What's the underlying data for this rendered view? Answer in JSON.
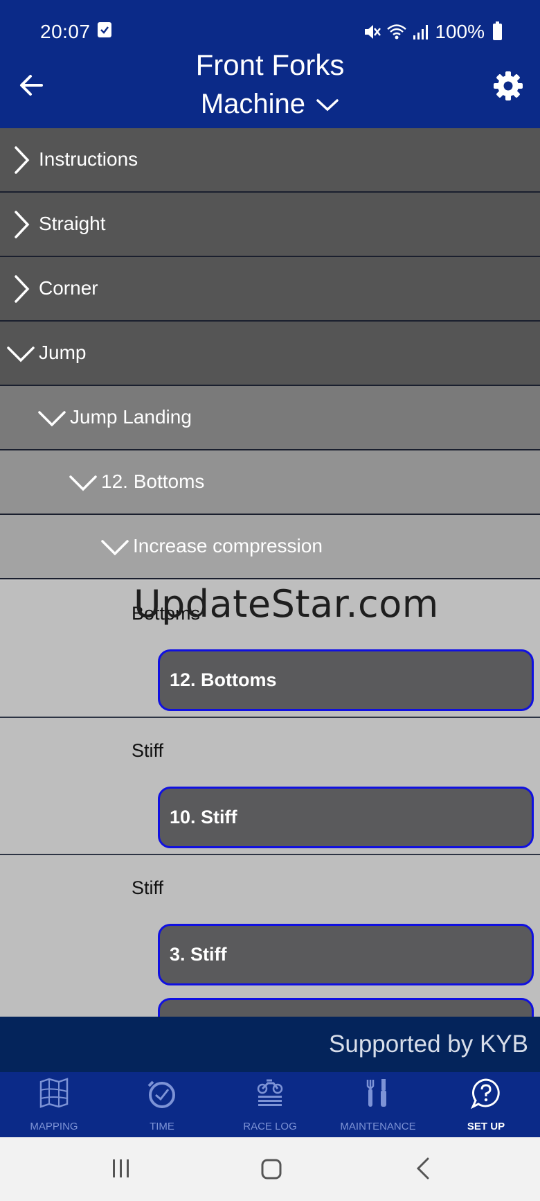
{
  "status": {
    "time": "20:07",
    "battery": "100%"
  },
  "header": {
    "title": "Front Forks",
    "subtitle": "Machine"
  },
  "accordion": [
    {
      "label": "Instructions",
      "expanded": false
    },
    {
      "label": "Straight",
      "expanded": false
    },
    {
      "label": "Corner",
      "expanded": false
    },
    {
      "label": "Jump",
      "expanded": true
    },
    {
      "label": "Jump Landing",
      "expanded": true
    },
    {
      "label": "12. Bottoms",
      "expanded": true
    },
    {
      "label": "Increase compression",
      "expanded": true
    }
  ],
  "groups": [
    {
      "title": "Bottoms",
      "button": "12. Bottoms"
    },
    {
      "title": "Stiff",
      "button": "10. Stiff"
    },
    {
      "title": "Stiff",
      "button": "3. Stiff"
    }
  ],
  "watermark": "UpdateStar.com",
  "footer": {
    "supported_by": "Supported by KYB"
  },
  "tabs": [
    {
      "label": "MAPPING",
      "icon": "map-icon",
      "active": false
    },
    {
      "label": "TIME",
      "icon": "stopwatch-icon",
      "active": false
    },
    {
      "label": "RACE LOG",
      "icon": "motorbike-log-icon",
      "active": false
    },
    {
      "label": "MAINTENANCE",
      "icon": "tools-icon",
      "active": false
    },
    {
      "label": "SET UP",
      "icon": "help-bubble-icon",
      "active": true
    }
  ],
  "colors": {
    "header_bg": "#0b2a88",
    "footer_bg": "#04245b",
    "button_border": "#1010e0"
  }
}
